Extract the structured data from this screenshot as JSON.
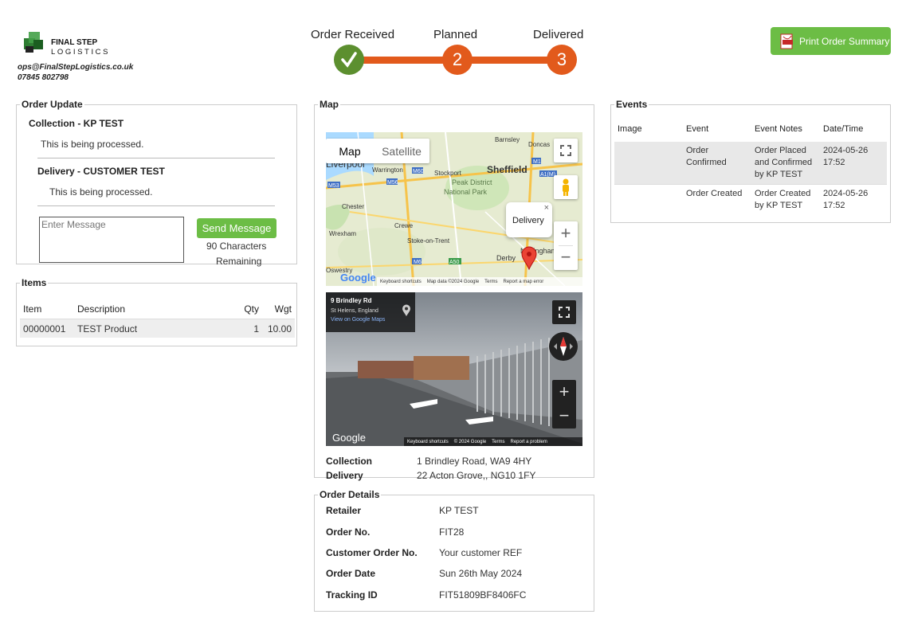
{
  "brand": {
    "name_line1": "FINAL STEP",
    "name_line2": "LOGISTICS",
    "email": "ops@FinalStepLogistics.co.uk",
    "phone": "07845 802798"
  },
  "progress": {
    "steps": [
      {
        "label": "Order Received",
        "number": "1",
        "state": "complete",
        "color": "#5c8f2f"
      },
      {
        "label": "Planned",
        "number": "2",
        "state": "pending",
        "color": "#e25a1c"
      },
      {
        "label": "Delivered",
        "number": "3",
        "state": "pending",
        "color": "#e25a1c"
      }
    ],
    "track_color": "#e25a1c"
  },
  "print_button": {
    "label": "Print Order Summary",
    "icon": "pdf-icon"
  },
  "order_update": {
    "legend": "Order Update",
    "collection_title": "Collection - KP TEST",
    "collection_status": "This is being processed.",
    "delivery_title": "Delivery - CUSTOMER TEST",
    "delivery_status": "This is being processed.",
    "message_placeholder": "Enter Message",
    "send_label": "Send Message",
    "chars_line1": "90 Characters",
    "chars_line2": "Remaining"
  },
  "items": {
    "legend": "Items",
    "headers": [
      "Item",
      "Description",
      "Qty",
      "Wgt"
    ],
    "rows": [
      [
        "00000001",
        "TEST Product",
        "1",
        "10.00"
      ]
    ]
  },
  "map": {
    "legend": "Map",
    "tabs": [
      "Map",
      "Satellite"
    ],
    "place_labels": [
      "Liverpool",
      "Warrington",
      "Stockport",
      "Sheffield",
      "Barnsley",
      "Doncas",
      "Chester",
      "Crewe",
      "Peak District",
      "National Park",
      "Wrexham",
      "Stoke-on-Trent",
      "Derby",
      "Nottingham",
      "Oswestry",
      "M56",
      "M60",
      "M6",
      "M1",
      "A1(M)",
      "M53",
      "A50"
    ],
    "popup_label": "Delivery",
    "map_footer": [
      "Keyboard shortcuts",
      "Map data ©2024 Google",
      "Terms",
      "Report a map error"
    ],
    "google_label": "Google",
    "street": {
      "address_title": "9 Brindley Rd",
      "address_sub": "St Helens, England",
      "link": "View on Google Maps",
      "footer": [
        "Keyboard shortcuts",
        "© 2024 Google",
        "Terms",
        "Report a problem"
      ]
    },
    "collection_label": "Collection",
    "collection_value": "1 Brindley Road, WA9 4HY",
    "delivery_label": "Delivery",
    "delivery_value": "22 Acton Grove,, NG10 1FY"
  },
  "order_details": {
    "legend": "Order Details",
    "fields": [
      {
        "label": "Retailer",
        "value": "KP TEST"
      },
      {
        "label": "Order No.",
        "value": "FIT28"
      },
      {
        "label": "Customer Order No.",
        "value": "Your customer REF"
      },
      {
        "label": "Order Date",
        "value": "Sun 26th May 2024"
      },
      {
        "label": "Tracking ID",
        "value": "FIT51809BF8406FC"
      }
    ]
  },
  "events": {
    "legend": "Events",
    "headers": [
      "Image",
      "Event",
      "Event Notes",
      "Date/Time"
    ],
    "rows": [
      {
        "image": "",
        "event": "Order Confirmed",
        "notes_lines": [
          "Order Placed",
          "and Confirmed",
          "by KP TEST"
        ],
        "date": "2024-05-26",
        "time": "17:52"
      },
      {
        "image": "",
        "event": "Order Created",
        "notes_lines": [
          "Order Created",
          "by KP TEST"
        ],
        "date": "2024-05-26",
        "time": "17:52"
      }
    ]
  }
}
